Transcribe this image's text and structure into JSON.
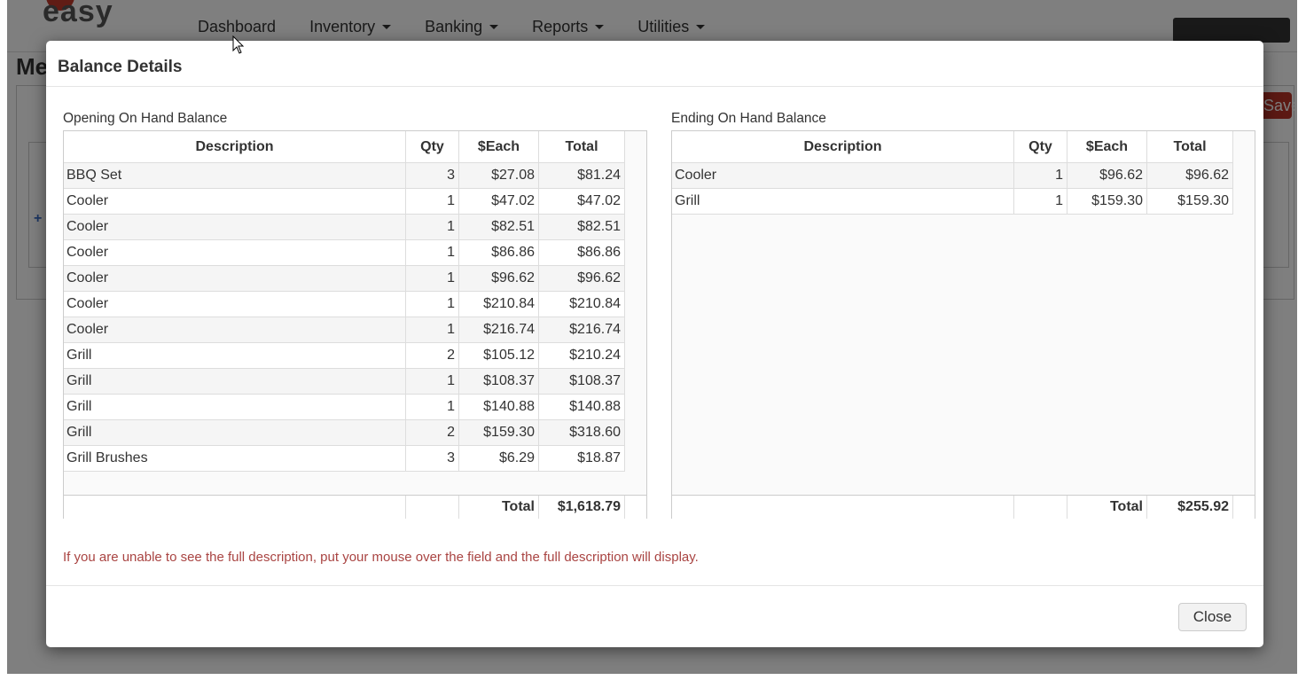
{
  "app": {
    "brand": "easy",
    "nav": [
      "Dashboard",
      "Inventory",
      "Banking",
      "Reports",
      "Utilities"
    ],
    "page_title": "Me",
    "save_label": "Save"
  },
  "modal": {
    "title": "Balance Details",
    "note": "If you are unable to see the full description, put your mouse over the field and the full description will display.",
    "close_label": "Close"
  },
  "columns": {
    "description": "Description",
    "qty": "Qty",
    "each": "$Each",
    "total": "Total"
  },
  "opening": {
    "label": "Opening On Hand Balance",
    "rows": [
      {
        "description": "BBQ Set",
        "qty": "3",
        "each": "$27.08",
        "total": "$81.24"
      },
      {
        "description": "Cooler",
        "qty": "1",
        "each": "$47.02",
        "total": "$47.02"
      },
      {
        "description": "Cooler",
        "qty": "1",
        "each": "$82.51",
        "total": "$82.51"
      },
      {
        "description": "Cooler",
        "qty": "1",
        "each": "$86.86",
        "total": "$86.86"
      },
      {
        "description": "Cooler",
        "qty": "1",
        "each": "$96.62",
        "total": "$96.62"
      },
      {
        "description": "Cooler",
        "qty": "1",
        "each": "$210.84",
        "total": "$210.84"
      },
      {
        "description": "Cooler",
        "qty": "1",
        "each": "$216.74",
        "total": "$216.74"
      },
      {
        "description": "Grill",
        "qty": "2",
        "each": "$105.12",
        "total": "$210.24"
      },
      {
        "description": "Grill",
        "qty": "1",
        "each": "$108.37",
        "total": "$108.37"
      },
      {
        "description": "Grill",
        "qty": "1",
        "each": "$140.88",
        "total": "$140.88"
      },
      {
        "description": "Grill",
        "qty": "2",
        "each": "$159.30",
        "total": "$318.60"
      },
      {
        "description": "Grill Brushes",
        "qty": "3",
        "each": "$6.29",
        "total": "$18.87"
      }
    ],
    "footer_label": "Total",
    "footer_total": "$1,618.79"
  },
  "ending": {
    "label": "Ending On Hand Balance",
    "rows": [
      {
        "description": "Cooler",
        "qty": "1",
        "each": "$96.62",
        "total": "$96.62"
      },
      {
        "description": "Grill",
        "qty": "1",
        "each": "$159.30",
        "total": "$159.30"
      }
    ],
    "footer_label": "Total",
    "footer_total": "$255.92"
  }
}
